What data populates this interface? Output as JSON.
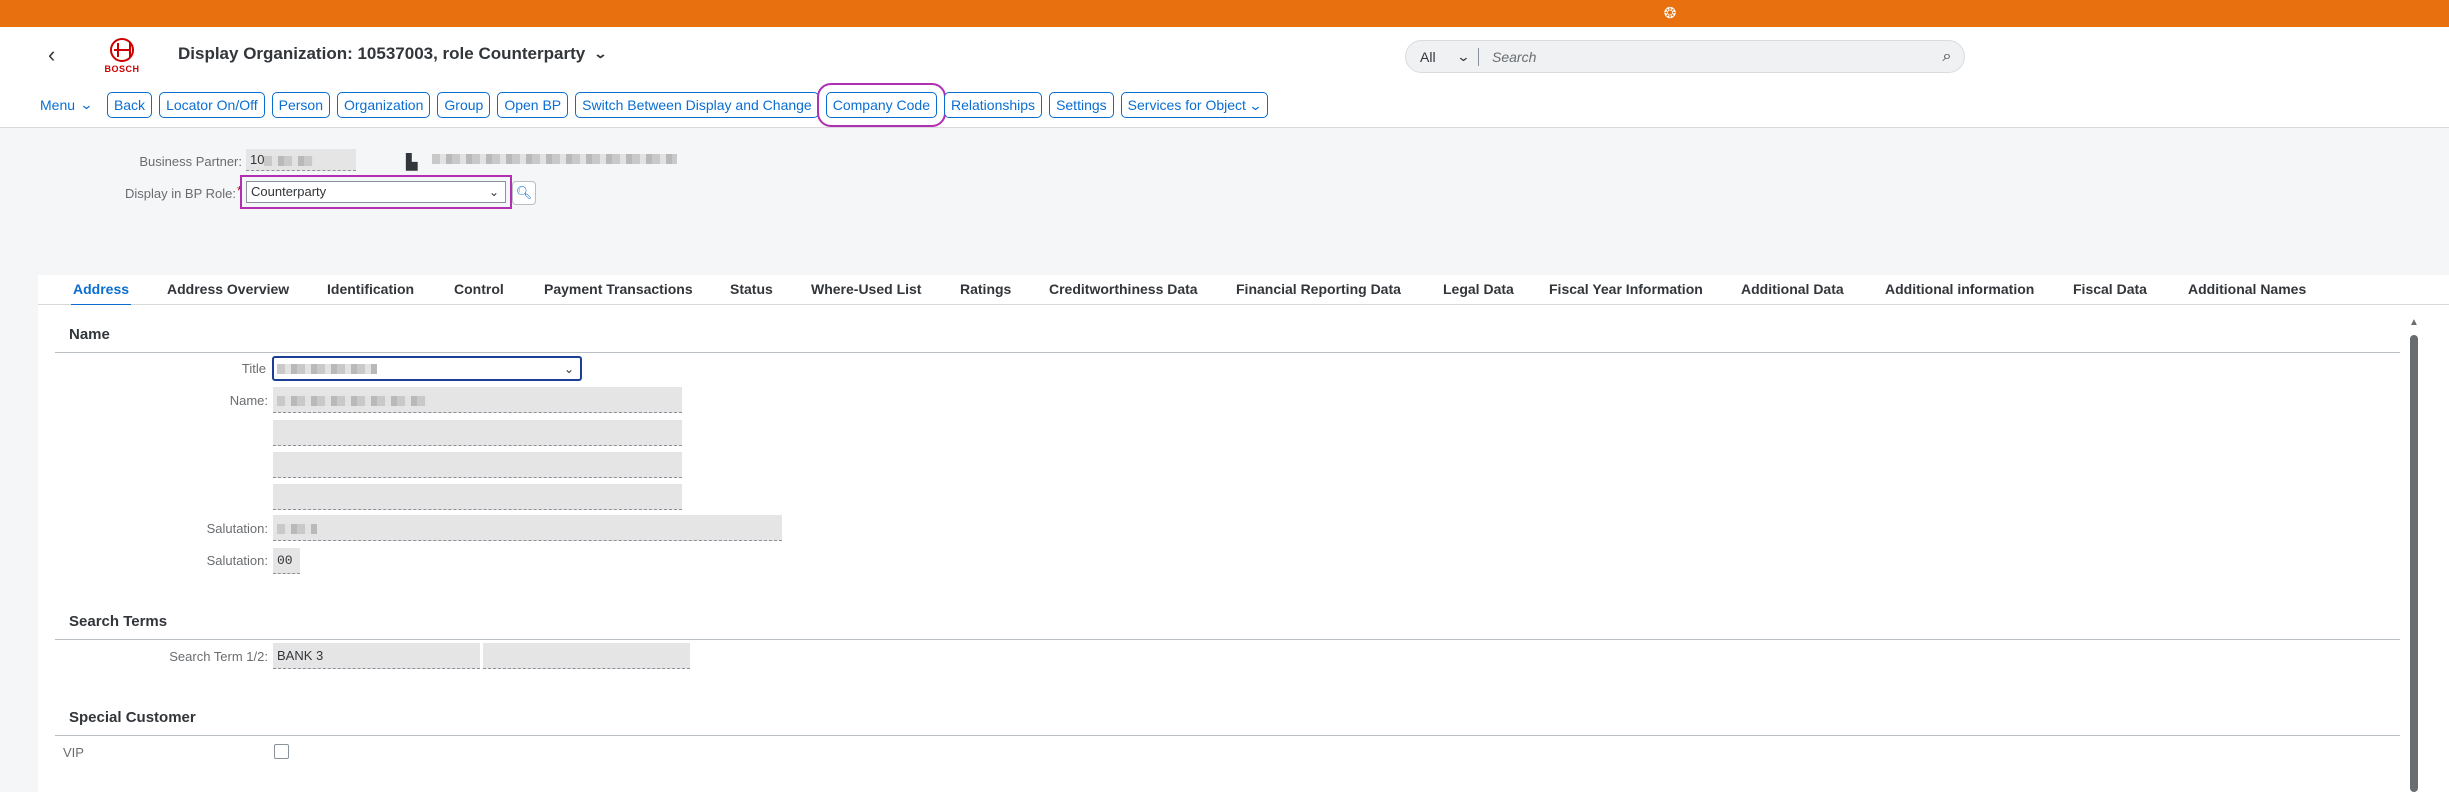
{
  "colors": {
    "brand": "#e8700e",
    "accent": "#0a6ed1",
    "highlight": "#b02fb3"
  },
  "shell": {
    "back_icon": "chevron-left-icon",
    "logo_text": "BOSCH",
    "title": "Display Organization: 10537003, role Counterparty",
    "search": {
      "scope": "All",
      "placeholder": "Search"
    }
  },
  "toolbar": {
    "menu_label": "Menu",
    "buttons": [
      "Back",
      "Locator On/Off",
      "Person",
      "Organization",
      "Group",
      "Open BP",
      "Switch Between Display and Change",
      "Company Code",
      "Relationships",
      "Settings",
      "Services for Object"
    ]
  },
  "header": {
    "bp_label": "Business Partner:",
    "bp_value": "10",
    "role_label": "Display in BP Role:",
    "role_required": "*",
    "role_value": "Counterparty"
  },
  "tabs": [
    "Address",
    "Address Overview",
    "Identification",
    "Control",
    "Payment Transactions",
    "Status",
    "Where-Used List",
    "Ratings",
    "Creditworthiness Data",
    "Financial Reporting Data",
    "Legal Data",
    "Fiscal Year Information",
    "Additional Data",
    "Additional information",
    "Fiscal Data",
    "Additional Names"
  ],
  "sections": {
    "name": {
      "title": "Name",
      "title_label": "Title",
      "name_label": "Name:",
      "salutation_label": "Salutation:",
      "salutation2_label": "Salutation:",
      "salutation2_value": "00"
    },
    "search_terms": {
      "title": "Search Terms",
      "label": "Search Term 1/2:",
      "value": "BANK 3"
    },
    "special_customer": {
      "title": "Special Customer",
      "vip_label": "VIP",
      "vip_checked": false
    }
  }
}
